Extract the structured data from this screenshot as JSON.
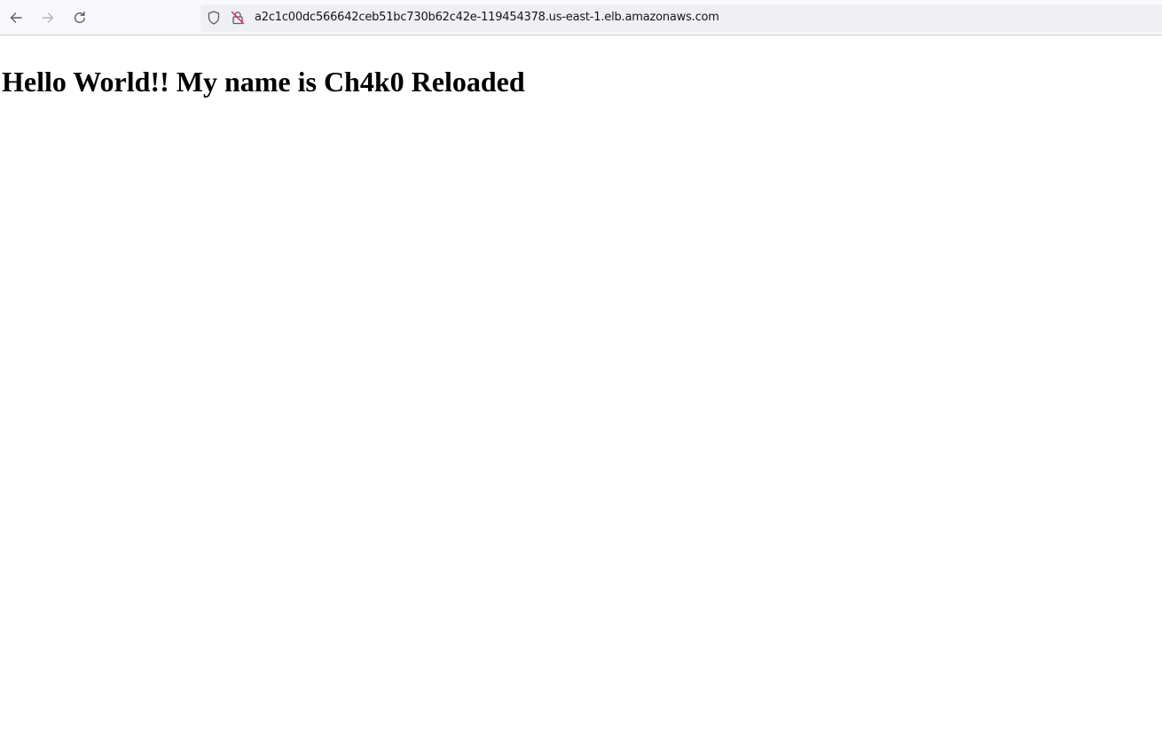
{
  "browser": {
    "back_icon": "arrow-left-icon",
    "forward_icon": "arrow-right-icon",
    "reload_icon": "reload-icon",
    "tracking_icon": "shield-icon",
    "security_icon": "insecure-lock-icon",
    "url": "a2c1c00dc566642ceb51bc730b62c42e-119454378.us-east-1.elb.amazonaws.com"
  },
  "page": {
    "heading": "Hello World!! My name is Ch4k0 Reloaded"
  },
  "colors": {
    "toolbar_bg": "#f9f9fb",
    "urlbar_bg": "#f0f0f4",
    "insecure_accent": "#e22850",
    "page_bg": "#ffffff"
  }
}
